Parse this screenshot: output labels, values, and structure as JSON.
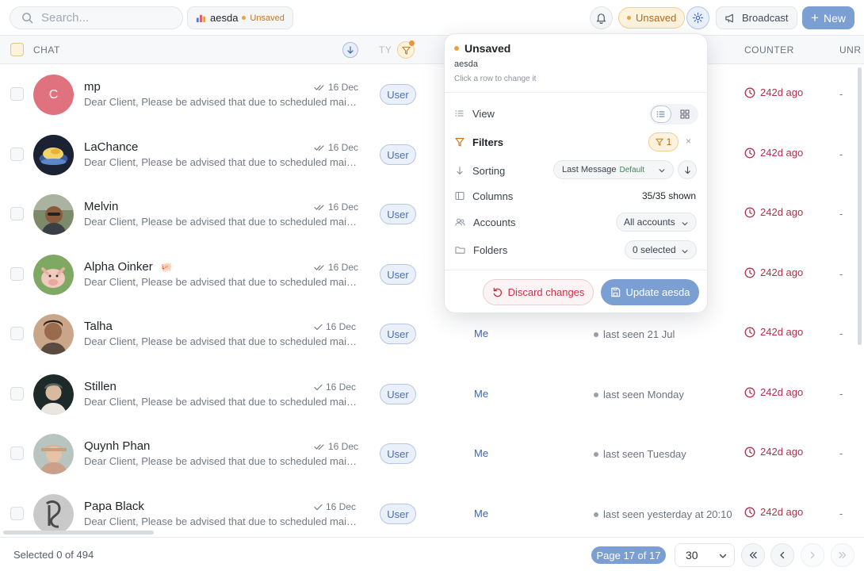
{
  "search": {
    "placeholder": "Search..."
  },
  "view_chip": {
    "name": "aesda",
    "status": "Unsaved"
  },
  "topbar": {
    "unsaved_label": "Unsaved",
    "broadcast_label": "Broadcast",
    "new_label": "New"
  },
  "table": {
    "headers": {
      "chat": "CHAT",
      "type": "TY",
      "counter": "COUNTER",
      "unread": "UNR"
    },
    "rows": [
      {
        "name": "mp",
        "avatar": "C",
        "preview": "Dear Client, Please be advised that due to scheduled maintenance on our servers",
        "date": "16 Dec",
        "type": "User",
        "assignee": "",
        "status": "",
        "counter": "242d ago",
        "unread": "-"
      },
      {
        "name": "LaChance",
        "preview": "Dear Client, Please be advised that due to scheduled maintenance on our servers",
        "date": "16 Dec",
        "type": "User",
        "assignee": "",
        "status": "",
        "counter": "242d ago",
        "unread": "-"
      },
      {
        "name": "Melvin",
        "preview": "Dear Client, Please be advised that due to scheduled maintenance on our servers",
        "date": "16 Dec",
        "type": "User",
        "assignee": "",
        "status": "",
        "counter": "242d ago",
        "unread": "-"
      },
      {
        "name": "Alpha Oinker",
        "emoji": "🐖",
        "preview": "Dear Client, Please be advised that due to scheduled maintenance on our servers",
        "date": "16 Dec",
        "type": "User",
        "assignee": "",
        "status": "",
        "counter": "242d ago",
        "unread": "-"
      },
      {
        "name": "Talha",
        "preview": "Dear Client, Please be advised that due to scheduled maintenance on our servers",
        "date": "16 Dec",
        "type": "User",
        "assignee": "Me",
        "status": "last seen 21 Jul",
        "counter": "242d ago",
        "unread": "-"
      },
      {
        "name": "Stillen",
        "preview": "Dear Client, Please be advised that due to scheduled maintenance on our servers",
        "date": "16 Dec",
        "type": "User",
        "assignee": "Me",
        "status": "last seen Monday",
        "counter": "242d ago",
        "unread": "-"
      },
      {
        "name": "Quynh Phan",
        "preview": "Dear Client, Please be advised that due to scheduled maintenance on our servers",
        "date": "16 Dec",
        "type": "User",
        "assignee": "Me",
        "status": "last seen Tuesday",
        "counter": "242d ago",
        "unread": "-"
      },
      {
        "name": "Papa Black",
        "preview": "Dear Client, Please be advised that due to scheduled maintenance on our servers",
        "date": "16 Dec",
        "type": "User",
        "assignee": "Me",
        "status": "last seen yesterday at 20:10",
        "counter": "242d ago",
        "unread": "-"
      }
    ]
  },
  "footer": {
    "selected_text": "Selected 0 of 494",
    "page_label": "Page 17 of 17",
    "page_size": "30"
  },
  "popover": {
    "title": "Unsaved",
    "subtitle": "aesda",
    "hint": "Click a row to change it",
    "view_label": "View",
    "filters_label": "Filters",
    "filters_count": "1",
    "sorting_label": "Sorting",
    "sorting_value": "Last Message",
    "sorting_default": "Default",
    "columns_label": "Columns",
    "columns_value": "35/35 shown",
    "accounts_label": "Accounts",
    "accounts_value": "All accounts",
    "folders_label": "Folders",
    "folders_value": "0 selected",
    "discard_label": "Discard changes",
    "update_label": "Update aesda"
  },
  "colors": {
    "accent": "#7b9fd2",
    "unsaved": "#e8a33d",
    "counter": "#b3304a",
    "discard": "#c8323f"
  }
}
